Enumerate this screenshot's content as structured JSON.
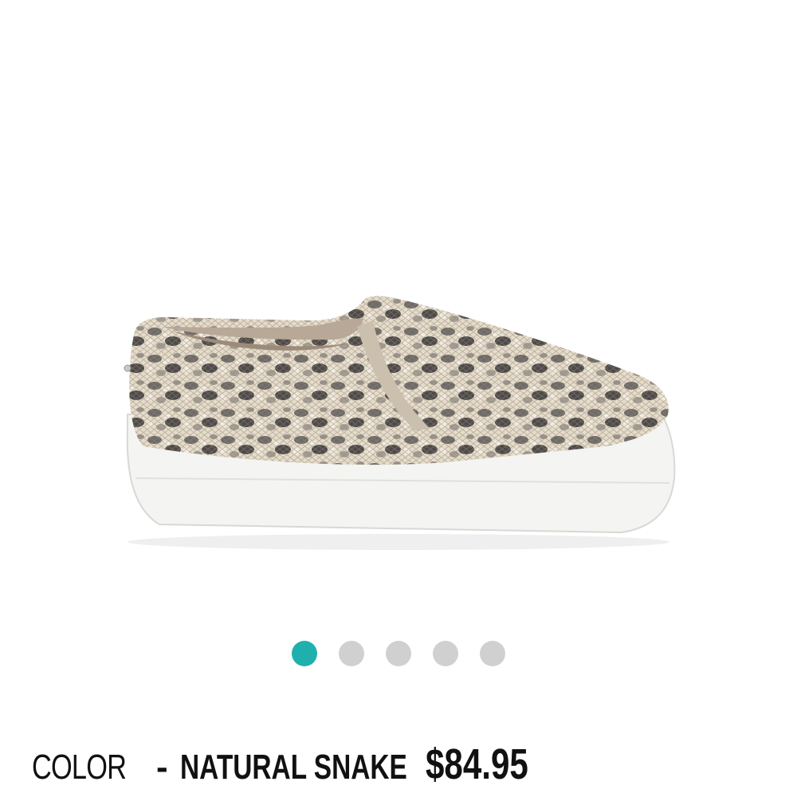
{
  "product": {
    "image_alt": "Natural snake print slip-on sneaker",
    "accent_color": "#1fb0ad"
  },
  "carousel": {
    "dot_count": 5,
    "active_index": 0
  },
  "info": {
    "color_prefix": "COLOR",
    "separator": "-",
    "color_name": "NATURAL SNAKE",
    "price": "$84.95"
  }
}
